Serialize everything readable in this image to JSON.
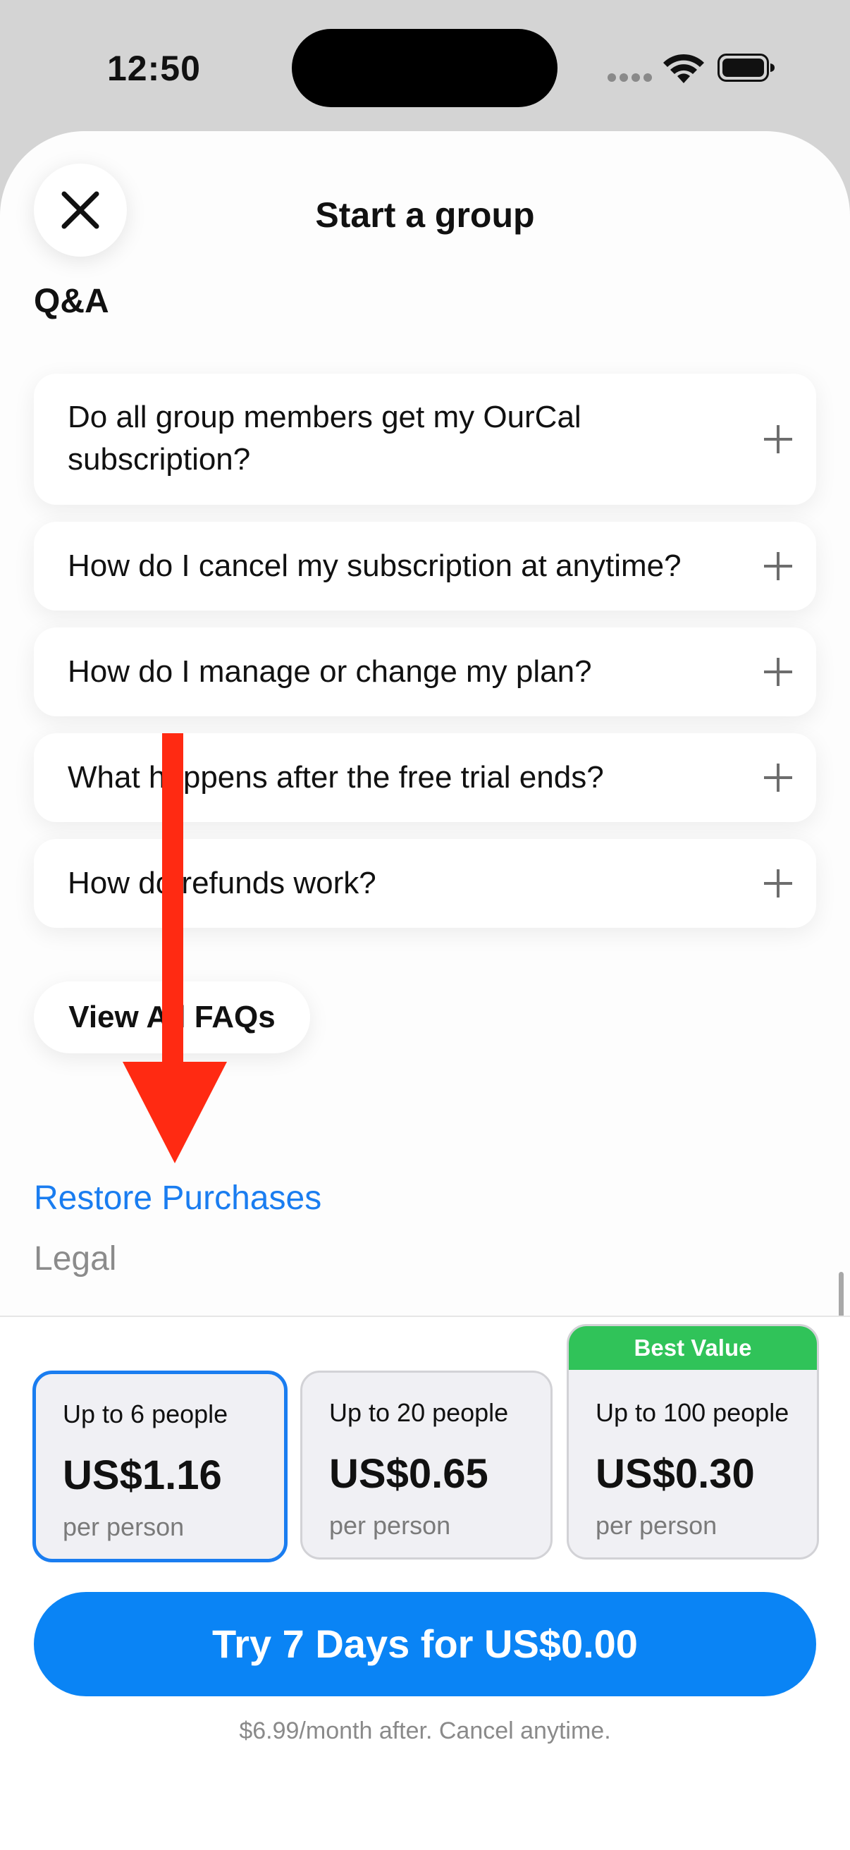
{
  "status_bar": {
    "time": "12:50",
    "icons": [
      "signal-icon",
      "wifi-icon",
      "battery-icon"
    ]
  },
  "sheet": {
    "title": "Start a group",
    "close_icon": "close-icon",
    "qa_heading": "Q&A",
    "faq_items": [
      {
        "question_line1": "Do all group members get my OurCal",
        "question_line2": "subscription?"
      },
      {
        "question": "How do I cancel my subscription at anytime?"
      },
      {
        "question": "How do I manage or change my plan?"
      },
      {
        "question": "What happens after the free trial ends?"
      },
      {
        "question": "How do refunds work?"
      }
    ],
    "view_all_label": "View All FAQs",
    "restore_label": "Restore Purchases",
    "legal_label": "Legal"
  },
  "plans": [
    {
      "label": "Up to 6 people",
      "price": "US$1.16",
      "per": "per person",
      "selected": true
    },
    {
      "label": "Up to 20 people",
      "price": "US$0.65",
      "per": "per person",
      "selected": false
    },
    {
      "label": "Up to 100 people",
      "price": "US$0.30",
      "per": "per person",
      "selected": false,
      "badge": "Best Value"
    }
  ],
  "cta": {
    "label": "Try 7 Days for US$0.00",
    "subtext": "$6.99/month after. Cancel anytime."
  },
  "colors": {
    "accent": "#0a84f5",
    "link": "#1a7df0",
    "badge": "#30c359",
    "annotation_arrow": "#ff2a12"
  }
}
